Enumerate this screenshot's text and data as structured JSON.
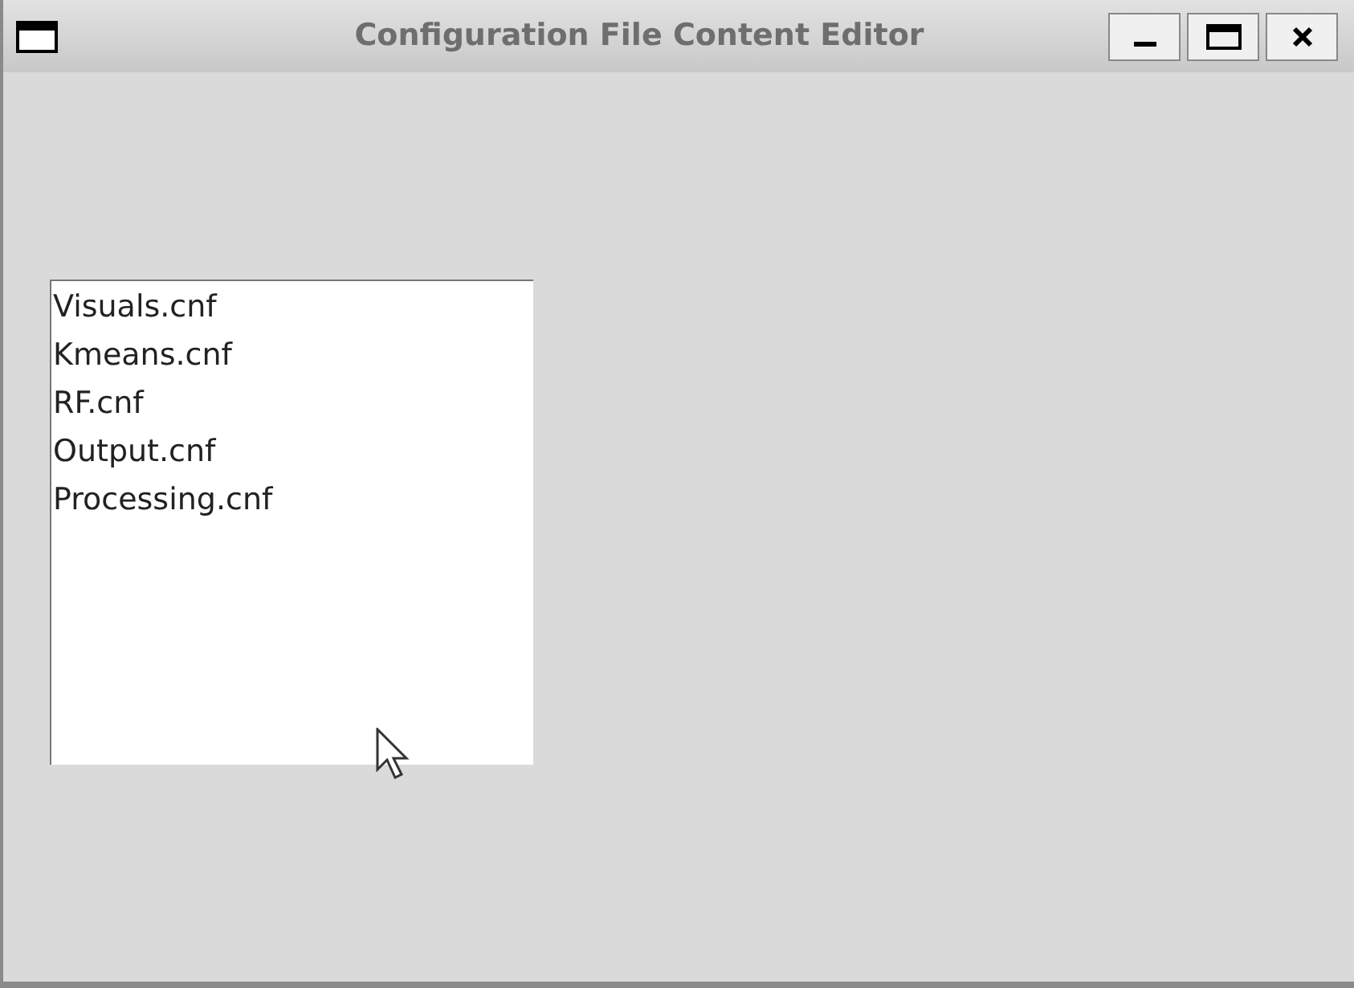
{
  "window": {
    "title": "Configuration File Content Editor"
  },
  "files": [
    "Visuals.cnf",
    "Kmeans.cnf",
    "RF.cnf",
    "Output.cnf",
    "Processing.cnf"
  ]
}
